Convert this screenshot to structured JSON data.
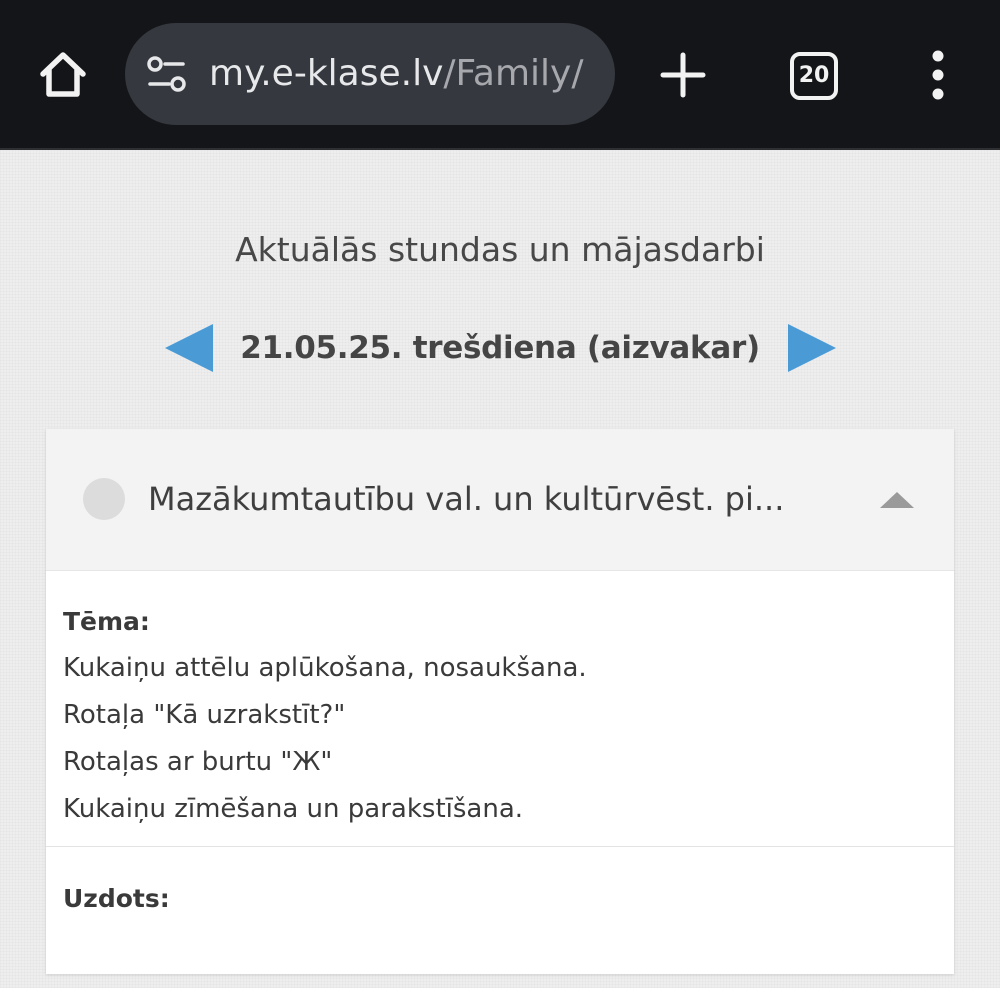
{
  "browser": {
    "url_domain": "my.e-klase.lv",
    "url_path": "/Family/",
    "tab_count": "20",
    "icons": {
      "home": "home-icon",
      "site_info": "tune-icon",
      "new_tab": "plus-icon",
      "tabs": "tab-switcher-icon",
      "menu": "more-vertical-icon"
    }
  },
  "page": {
    "heading": "Aktuālās stundas un mājasdarbi",
    "date_label": "21.05.25. trešdiena (aizvakar)",
    "nav_arrow_color": "#4a9ad6"
  },
  "lesson": {
    "title": "Mazākumtautību val. un kultūrvēst. pi...",
    "status_color": "#dcdcdc",
    "topic_label": "Tēma:",
    "topic_lines": [
      "Kukaiņu attēlu aplūkošana, nosaukšana.",
      "Rotaļa \"Kā uzrakstīt?\"",
      "Rotaļas ar burtu \"Ж\"",
      "Kukaiņu zīmēšana un parakstīšana."
    ],
    "assigned_label": "Uzdots:"
  }
}
